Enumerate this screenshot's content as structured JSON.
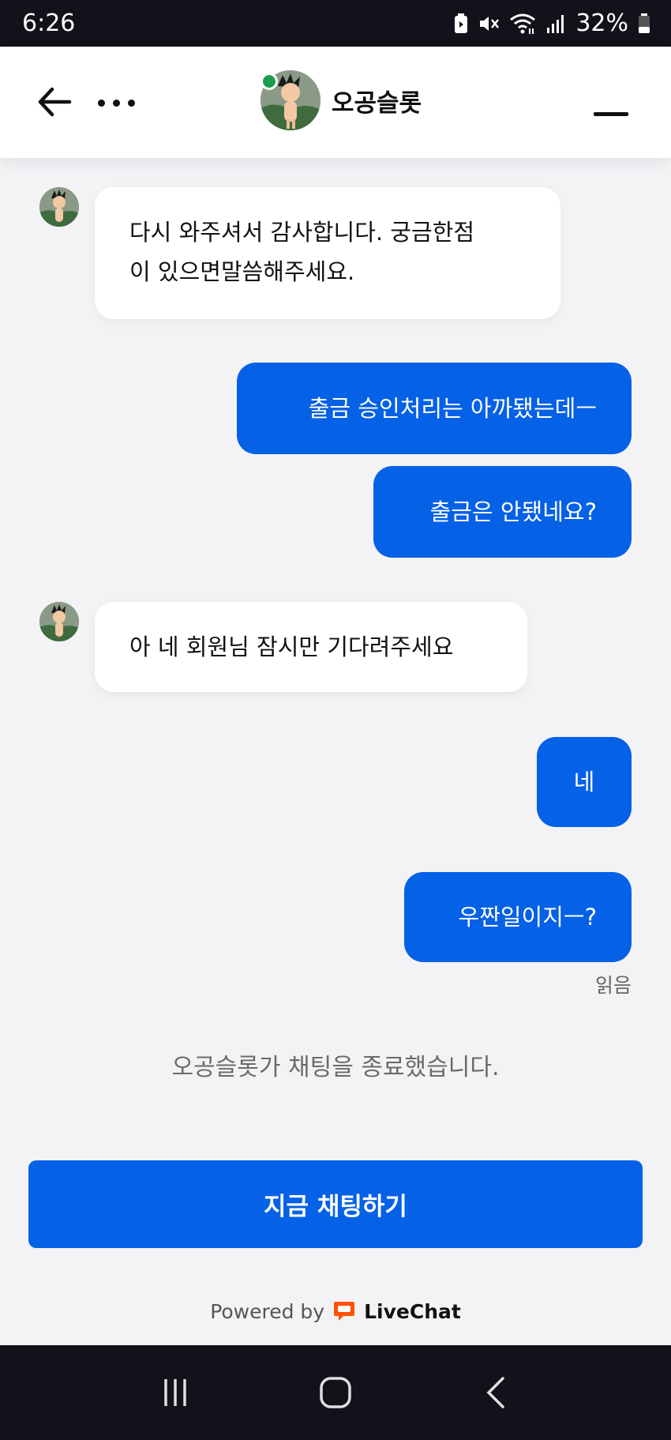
{
  "status_bar": {
    "time": "6:26",
    "battery": "32%",
    "icons": [
      "battery-saver-icon",
      "mute-icon",
      "wifi-icon",
      "signal-icon",
      "battery-icon"
    ]
  },
  "header": {
    "agent_name": "오공슬롯",
    "online_color": "#1e9b4f",
    "back_icon": "arrow-left-icon",
    "more_icon": "more-dots-icon",
    "minimize_icon": "minimize-icon"
  },
  "messages": [
    {
      "from": "agent",
      "lines": [
        "다시 와주셔서 감사합니다. 궁금한점",
        "이 있으면말씀해주세요."
      ]
    },
    {
      "from": "user",
      "text": "출금 승인처리는 아까됐는데ㅡ"
    },
    {
      "from": "user",
      "text": "출금은 안됐네요?"
    },
    {
      "from": "agent",
      "text": "아 네 회원님 잠시만 기다려주세요"
    },
    {
      "from": "user",
      "text": "네"
    },
    {
      "from": "user",
      "text": "우짠일이지ㅡ?"
    }
  ],
  "read_status": "읽음",
  "chat_ended": "오공슬롯가 채팅을 종료했습니다.",
  "chat_now_label": "지금 채팅하기",
  "footer": {
    "powered_by": "Powered by",
    "brand": "LiveChat",
    "brand_color": "#ff5100"
  },
  "colors": {
    "accent": "#0561e6",
    "background": "#f3f2f5"
  },
  "nav_bar": {
    "icons": [
      "recent-apps-icon",
      "home-icon",
      "back-nav-icon"
    ]
  }
}
